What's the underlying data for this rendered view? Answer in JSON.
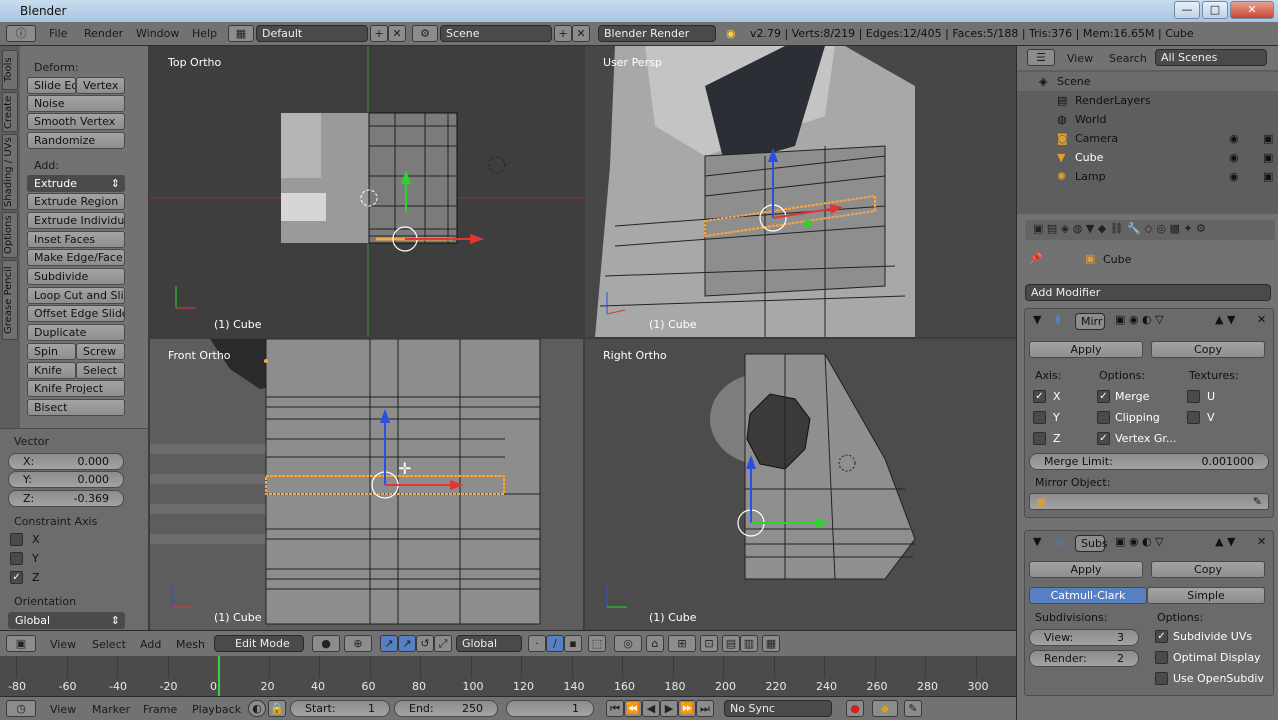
{
  "window": {
    "title": "Blender",
    "minimize": "—",
    "maximize": "□",
    "close": "✕"
  },
  "topbar": {
    "menus": [
      "File",
      "Render",
      "Window",
      "Help"
    ],
    "layout": "Default",
    "scene": "Scene",
    "engine": "Blender Render",
    "stats": "v2.79 | Verts:8/219 | Edges:12/405 | Faces:5/188 | Tris:376 | Mem:16.65M | Cube"
  },
  "tools": {
    "tabs": [
      "Tools",
      "Create",
      "Shading / UVs",
      "Options",
      "Grease Pencil"
    ],
    "deform_title": "Deform:",
    "deform": [
      [
        "Slide Ed",
        "Vertex"
      ],
      [
        "Noise"
      ],
      [
        "Smooth Vertex"
      ],
      [
        "Randomize"
      ]
    ],
    "add_title": "Add:",
    "extrude": "Extrude",
    "add": [
      "Extrude Region",
      "Extrude Individual",
      "Inset Faces",
      "Make Edge/Face",
      "Subdivide",
      "Loop Cut and Slide",
      "Offset Edge Slide",
      "Duplicate"
    ],
    "spin": "Spin",
    "screw": "Screw",
    "knife": "Knife",
    "select": "Select",
    "knife_project": "Knife Project",
    "bisect": "Bisect"
  },
  "operator": {
    "vector_title": "Vector",
    "x_label": "X:",
    "x": "0.000",
    "y_label": "Y:",
    "y": "0.000",
    "z_label": "Z:",
    "z": "-0.369",
    "constraint_title": "Constraint Axis",
    "cx": "X",
    "cy": "Y",
    "cz": "Z",
    "orientation_title": "Orientation",
    "orientation": "Global"
  },
  "viewports": {
    "top": "Top Ortho",
    "user": "User Persp",
    "front": "Front Ortho",
    "right": "Right Ortho",
    "object": "(1) Cube"
  },
  "header3d": {
    "menus": [
      "View",
      "Select",
      "Add",
      "Mesh"
    ],
    "mode": "Edit Mode",
    "orientation": "Global"
  },
  "timeline": {
    "ticks": [
      "-80",
      "-60",
      "-40",
      "-20",
      "0",
      "20",
      "40",
      "60",
      "80",
      "100",
      "120",
      "140",
      "160",
      "180",
      "200",
      "220",
      "240",
      "260",
      "280",
      "300"
    ],
    "current_frame": 0
  },
  "tlbar": {
    "menus": [
      "View",
      "Marker",
      "Frame",
      "Playback"
    ],
    "start_label": "Start:",
    "start": "1",
    "end_label": "End:",
    "end": "250",
    "frame": "1",
    "sync": "No Sync"
  },
  "outliner": {
    "view": "View",
    "search": "Search",
    "scenes": "All Scenes",
    "items": [
      "Scene",
      "RenderLayers",
      "World",
      "Camera",
      "Cube",
      "Lamp"
    ]
  },
  "properties": {
    "object": "Cube",
    "add_modifier": "Add Modifier",
    "mirror": {
      "name": "Mirr",
      "apply": "Apply",
      "copy": "Copy",
      "axis_title": "Axis:",
      "options_title": "Options:",
      "textures_title": "Textures:",
      "axis": [
        "X",
        "Y",
        "Z"
      ],
      "options": [
        "Merge",
        "Clipping",
        "Vertex Gr..."
      ],
      "textures": [
        "U",
        "V"
      ],
      "merge_label": "Merge Limit:",
      "merge_value": "0.001000",
      "mirror_object": "Mirror Object:"
    },
    "subsurf": {
      "name": "Subs",
      "apply": "Apply",
      "copy": "Copy",
      "catmull": "Catmull-Clark",
      "simple": "Simple",
      "subdiv_title": "Subdivisions:",
      "options_title": "Options:",
      "view_label": "View:",
      "view_value": "3",
      "render_label": "Render:",
      "render_value": "2",
      "opts": [
        "Subdivide UVs",
        "Optimal Display",
        "Use OpenSubdiv"
      ]
    }
  },
  "colors": {
    "accent": "#5680c2",
    "selection": "#f7a644",
    "axis_x": "#e53434",
    "axis_y": "#2bd32b",
    "axis_z": "#2b4fe0"
  }
}
